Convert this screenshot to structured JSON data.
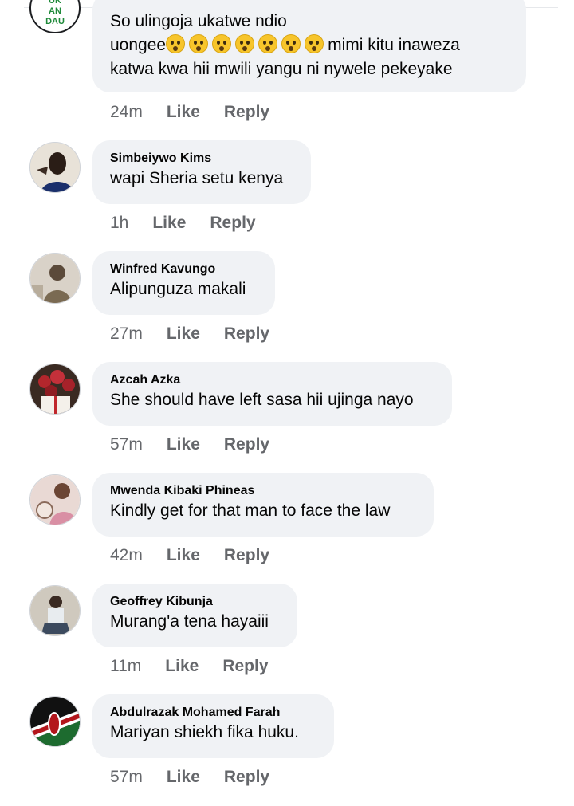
{
  "comments": [
    {
      "author": "",
      "avatar_text": [
        "UK",
        "AN",
        "DAU"
      ],
      "lines": [
        "So ulingoja ukatwe ndio",
        "uongee",
        "mimi kitu inaweza",
        "katwa kwa hii mwili yangu ni nywele pekeyake"
      ],
      "emoji_count": 7,
      "emoji_icon": "astonished-face-emoji",
      "time": "24m",
      "like": "Like",
      "reply": "Reply"
    },
    {
      "author": "Simbeiywo Kims",
      "text": "wapi Sheria setu kenya",
      "time": "1h",
      "like": "Like",
      "reply": "Reply"
    },
    {
      "author": "Winfred Kavungo",
      "text": "Alipunguza makali",
      "time": "27m",
      "like": "Like",
      "reply": "Reply"
    },
    {
      "author": "Azcah Azka",
      "text": "She should have left sasa hii ujinga nayo",
      "time": "57m",
      "like": "Like",
      "reply": "Reply"
    },
    {
      "author": "Mwenda Kibaki Phineas",
      "text": "Kindly get for that man to face the law",
      "time": "42m",
      "like": "Like",
      "reply": "Reply"
    },
    {
      "author": "Geoffrey Kibunja",
      "text": "Murang'a tena hayaiii",
      "time": "11m",
      "like": "Like",
      "reply": "Reply"
    },
    {
      "author": "Abdulrazak Mohamed Farah",
      "text": "Mariyan shiekh  fika huku.",
      "time": "57m",
      "like": "Like",
      "reply": "Reply"
    }
  ],
  "colors": {
    "bubble": "#f0f2f5",
    "meta_text": "#65676b",
    "emoji": "#f7c52b"
  }
}
